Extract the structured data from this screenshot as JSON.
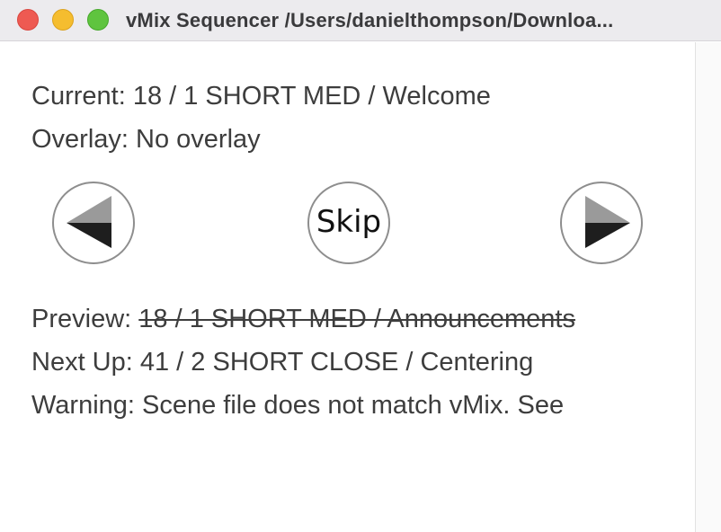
{
  "window": {
    "title": "vMix Sequencer /Users/danielthompson/Downloa..."
  },
  "status": {
    "current": "Current: 18 / 1 SHORT MED / Welcome",
    "overlay": "Overlay: No overlay",
    "preview_label": "Preview: ",
    "preview_value": "18 / 1 SHORT MED / Announcements",
    "next_up": "Next Up: 41 / 2 SHORT CLOSE / Centering",
    "warning": "Warning: Scene file does not match vMix. See"
  },
  "controls": {
    "previous_icon": "triangle-left-icon",
    "skip_label": "Skip",
    "next_icon": "triangle-right-icon"
  },
  "colors": {
    "close": "#ee5a52",
    "minimize": "#f5bd2f",
    "zoom": "#5fc43f",
    "text": "#3d3d3d"
  }
}
